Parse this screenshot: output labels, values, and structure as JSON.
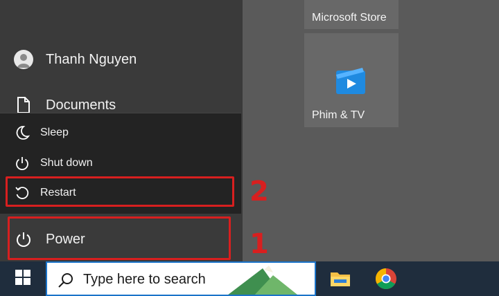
{
  "start_menu": {
    "user_name": "Thanh Nguyen",
    "documents_label": "Documents",
    "power_label": "Power"
  },
  "power_menu": {
    "sleep_label": "Sleep",
    "shutdown_label": "Shut down",
    "restart_label": "Restart"
  },
  "tiles": {
    "store_label": "Microsoft Store",
    "movies_label": "Phim & TV"
  },
  "annotations": {
    "step_power": "1",
    "step_restart": "2",
    "highlight_color": "#d81f1f"
  },
  "taskbar": {
    "search_placeholder": "Type here to search",
    "pinned": [
      "file-explorer-icon",
      "chrome-icon"
    ]
  }
}
